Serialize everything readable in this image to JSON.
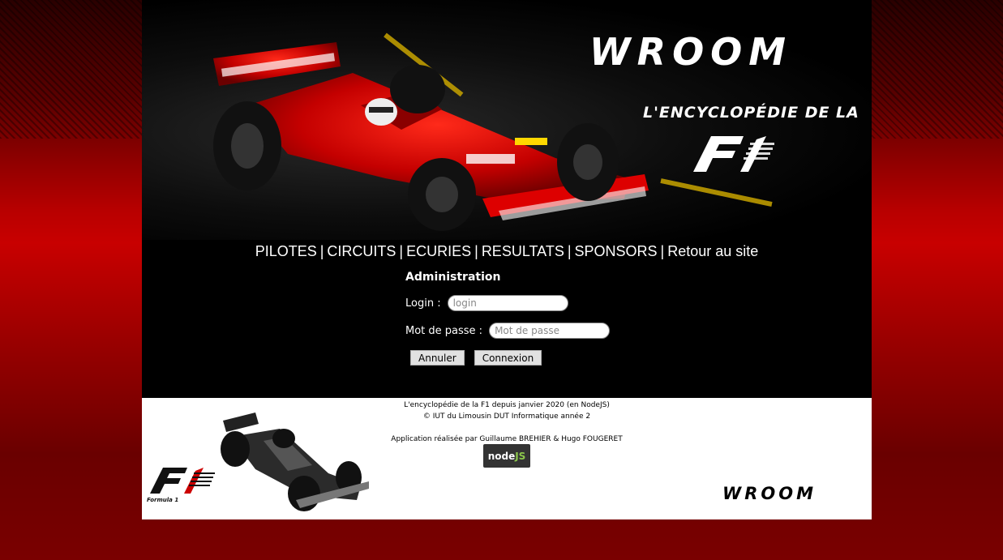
{
  "header": {
    "logo_text": "WROOM",
    "tagline": "L'ENCYCLOPÉDIE DE LA",
    "f1_logo": "F1"
  },
  "nav": {
    "items": [
      {
        "label": "PILOTES"
      },
      {
        "label": "CIRCUITS"
      },
      {
        "label": "ECURIES"
      },
      {
        "label": "RESULTATS"
      },
      {
        "label": "SPONSORS"
      },
      {
        "label": "Retour au site"
      }
    ],
    "separator": "|"
  },
  "admin": {
    "title": "Administration",
    "login_label": "Login :",
    "login_placeholder": "login",
    "login_value": "",
    "password_label": "Mot de passe :",
    "password_placeholder": "Mot de passe",
    "password_value": "",
    "cancel_label": "Annuler",
    "submit_label": "Connexion"
  },
  "footer": {
    "line1": "L'encyclopédie de la F1 depuis janvier 2020 (en NodeJS)",
    "line2": "© IUT du Limousin DUT Informatique année 2",
    "line3": "Application réalisée par Guillaume BREHIER & Hugo FOUGERET",
    "nodejs_badge_node": "node",
    "nodejs_badge_js": "JS",
    "f1_caption": "Formula 1",
    "logo_text": "WROOM"
  },
  "colors": {
    "accent_red": "#c80000",
    "header_bg": "#000000",
    "footer_bg": "#ffffff"
  }
}
